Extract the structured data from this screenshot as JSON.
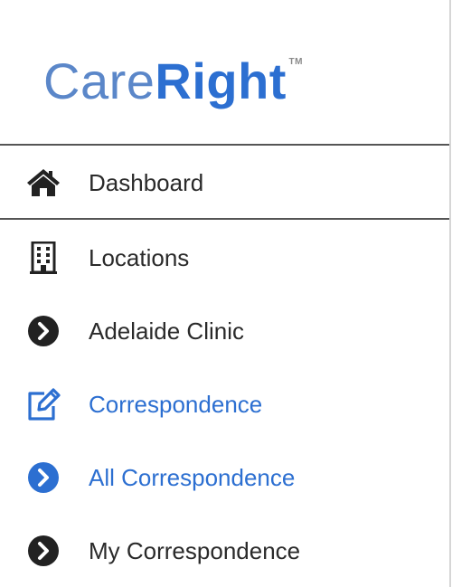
{
  "brand": {
    "logo_part1": "Care",
    "logo_part2": "Right",
    "trademark": "TM"
  },
  "colors": {
    "accent": "#2c6fd1",
    "text": "#2a2a2a",
    "icon": "#222222"
  },
  "nav": {
    "items": [
      {
        "label": "Dashboard",
        "icon": "home-icon"
      },
      {
        "label": "Locations",
        "icon": "building-icon"
      },
      {
        "label": "Adelaide Clinic",
        "icon": "chevron-circle-right-icon"
      },
      {
        "label": "Correspondence",
        "icon": "edit-icon",
        "active": true
      },
      {
        "label": "All Correspondence",
        "icon": "chevron-circle-right-icon",
        "active": true
      },
      {
        "label": "My Correspondence",
        "icon": "chevron-circle-right-icon"
      }
    ]
  }
}
